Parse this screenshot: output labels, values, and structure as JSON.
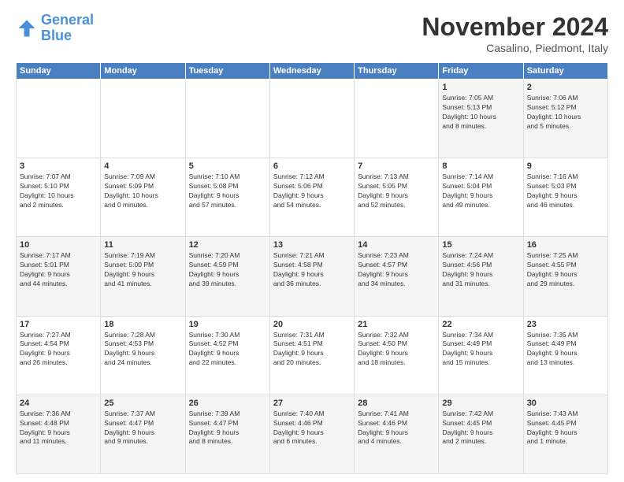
{
  "logo": {
    "line1": "General",
    "line2": "Blue"
  },
  "title": "November 2024",
  "subtitle": "Casalino, Piedmont, Italy",
  "days_header": [
    "Sunday",
    "Monday",
    "Tuesday",
    "Wednesday",
    "Thursday",
    "Friday",
    "Saturday"
  ],
  "weeks": [
    [
      {
        "day": "",
        "info": ""
      },
      {
        "day": "",
        "info": ""
      },
      {
        "day": "",
        "info": ""
      },
      {
        "day": "",
        "info": ""
      },
      {
        "day": "",
        "info": ""
      },
      {
        "day": "1",
        "info": "Sunrise: 7:05 AM\nSunset: 5:13 PM\nDaylight: 10 hours\nand 8 minutes."
      },
      {
        "day": "2",
        "info": "Sunrise: 7:06 AM\nSunset: 5:12 PM\nDaylight: 10 hours\nand 5 minutes."
      }
    ],
    [
      {
        "day": "3",
        "info": "Sunrise: 7:07 AM\nSunset: 5:10 PM\nDaylight: 10 hours\nand 2 minutes."
      },
      {
        "day": "4",
        "info": "Sunrise: 7:09 AM\nSunset: 5:09 PM\nDaylight: 10 hours\nand 0 minutes."
      },
      {
        "day": "5",
        "info": "Sunrise: 7:10 AM\nSunset: 5:08 PM\nDaylight: 9 hours\nand 57 minutes."
      },
      {
        "day": "6",
        "info": "Sunrise: 7:12 AM\nSunset: 5:06 PM\nDaylight: 9 hours\nand 54 minutes."
      },
      {
        "day": "7",
        "info": "Sunrise: 7:13 AM\nSunset: 5:05 PM\nDaylight: 9 hours\nand 52 minutes."
      },
      {
        "day": "8",
        "info": "Sunrise: 7:14 AM\nSunset: 5:04 PM\nDaylight: 9 hours\nand 49 minutes."
      },
      {
        "day": "9",
        "info": "Sunrise: 7:16 AM\nSunset: 5:03 PM\nDaylight: 9 hours\nand 46 minutes."
      }
    ],
    [
      {
        "day": "10",
        "info": "Sunrise: 7:17 AM\nSunset: 5:01 PM\nDaylight: 9 hours\nand 44 minutes."
      },
      {
        "day": "11",
        "info": "Sunrise: 7:19 AM\nSunset: 5:00 PM\nDaylight: 9 hours\nand 41 minutes."
      },
      {
        "day": "12",
        "info": "Sunrise: 7:20 AM\nSunset: 4:59 PM\nDaylight: 9 hours\nand 39 minutes."
      },
      {
        "day": "13",
        "info": "Sunrise: 7:21 AM\nSunset: 4:58 PM\nDaylight: 9 hours\nand 36 minutes."
      },
      {
        "day": "14",
        "info": "Sunrise: 7:23 AM\nSunset: 4:57 PM\nDaylight: 9 hours\nand 34 minutes."
      },
      {
        "day": "15",
        "info": "Sunrise: 7:24 AM\nSunset: 4:56 PM\nDaylight: 9 hours\nand 31 minutes."
      },
      {
        "day": "16",
        "info": "Sunrise: 7:25 AM\nSunset: 4:55 PM\nDaylight: 9 hours\nand 29 minutes."
      }
    ],
    [
      {
        "day": "17",
        "info": "Sunrise: 7:27 AM\nSunset: 4:54 PM\nDaylight: 9 hours\nand 26 minutes."
      },
      {
        "day": "18",
        "info": "Sunrise: 7:28 AM\nSunset: 4:53 PM\nDaylight: 9 hours\nand 24 minutes."
      },
      {
        "day": "19",
        "info": "Sunrise: 7:30 AM\nSunset: 4:52 PM\nDaylight: 9 hours\nand 22 minutes."
      },
      {
        "day": "20",
        "info": "Sunrise: 7:31 AM\nSunset: 4:51 PM\nDaylight: 9 hours\nand 20 minutes."
      },
      {
        "day": "21",
        "info": "Sunrise: 7:32 AM\nSunset: 4:50 PM\nDaylight: 9 hours\nand 18 minutes."
      },
      {
        "day": "22",
        "info": "Sunrise: 7:34 AM\nSunset: 4:49 PM\nDaylight: 9 hours\nand 15 minutes."
      },
      {
        "day": "23",
        "info": "Sunrise: 7:35 AM\nSunset: 4:49 PM\nDaylight: 9 hours\nand 13 minutes."
      }
    ],
    [
      {
        "day": "24",
        "info": "Sunrise: 7:36 AM\nSunset: 4:48 PM\nDaylight: 9 hours\nand 11 minutes."
      },
      {
        "day": "25",
        "info": "Sunrise: 7:37 AM\nSunset: 4:47 PM\nDaylight: 9 hours\nand 9 minutes."
      },
      {
        "day": "26",
        "info": "Sunrise: 7:39 AM\nSunset: 4:47 PM\nDaylight: 9 hours\nand 8 minutes."
      },
      {
        "day": "27",
        "info": "Sunrise: 7:40 AM\nSunset: 4:46 PM\nDaylight: 9 hours\nand 6 minutes."
      },
      {
        "day": "28",
        "info": "Sunrise: 7:41 AM\nSunset: 4:46 PM\nDaylight: 9 hours\nand 4 minutes."
      },
      {
        "day": "29",
        "info": "Sunrise: 7:42 AM\nSunset: 4:45 PM\nDaylight: 9 hours\nand 2 minutes."
      },
      {
        "day": "30",
        "info": "Sunrise: 7:43 AM\nSunset: 4:45 PM\nDaylight: 9 hours\nand 1 minute."
      }
    ]
  ]
}
